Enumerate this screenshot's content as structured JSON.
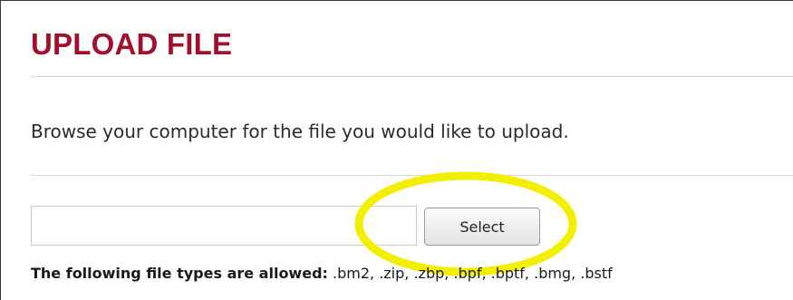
{
  "page": {
    "title": "UPLOAD FILE",
    "instructions": "Browse your computer for the file you would like to upload."
  },
  "upload": {
    "file_path_value": "",
    "file_path_placeholder": "",
    "select_label": "Select"
  },
  "allowed": {
    "label": "The following file types are allowed:",
    "types": ".bm2, .zip, .zbp, .bpf, .bptf, .bmg, .bstf"
  },
  "colors": {
    "title": "#a0122c",
    "highlight_ring": "#f2f000",
    "divider": "#d6d6d6"
  }
}
